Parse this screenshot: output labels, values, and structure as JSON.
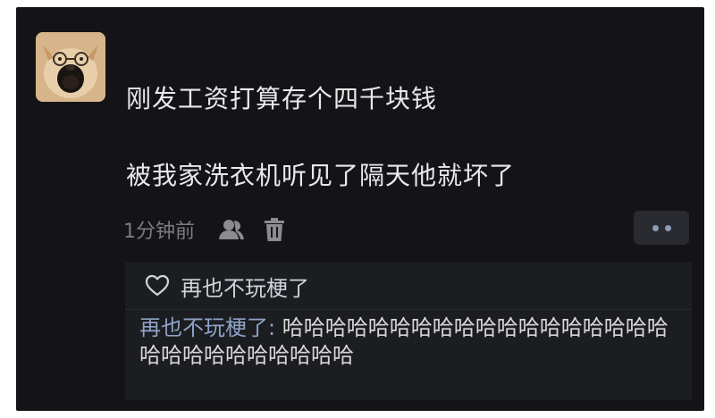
{
  "post": {
    "line1": "刚发工资打算存个四千块钱",
    "line2": "被我家洗衣机听见了隔天他就坏了",
    "time": "1分钟前"
  },
  "reply": {
    "liker": "再也不玩梗了",
    "author": "再也不玩梗了:",
    "text": " 哈哈哈哈哈哈哈哈哈哈哈哈哈哈哈哈哈哈哈哈哈哈哈哈哈哈哈哈"
  },
  "icons": {
    "author_icon": "person-icon",
    "delete_icon": "trash-icon",
    "more_icon": "more-dots-icon",
    "like_icon": "heart-outline-icon"
  },
  "colors": {
    "background": "#141417",
    "text": "#e9e9ec",
    "muted": "#7b7b82",
    "link": "#8fa3c7"
  }
}
